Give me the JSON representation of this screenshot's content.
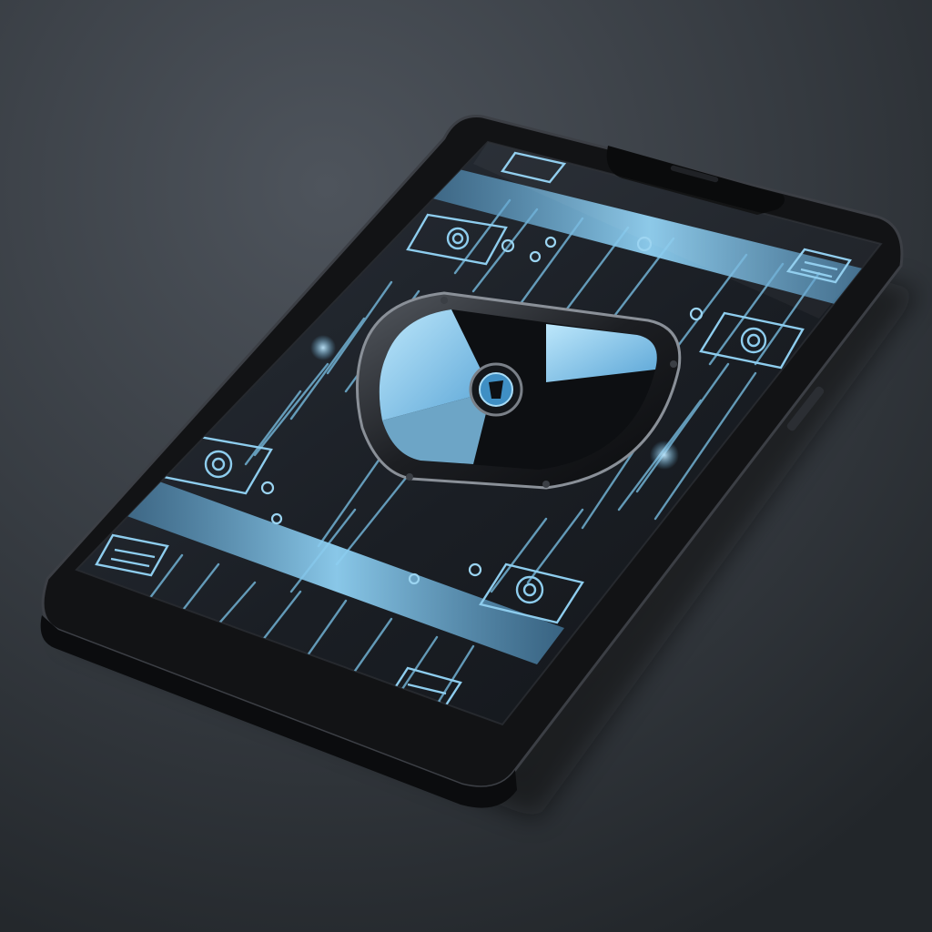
{
  "scene": {
    "subject": "smartphone-with-security-shield",
    "palette": {
      "background_light": "#4a5058",
      "background_dark": "#1f2327",
      "phone_body": "#141517",
      "phone_rim": "#3a3d42",
      "screen": "#1c2128",
      "accent_blue": "#7cc4ea",
      "accent_blue_bright": "#a9dcf6",
      "shield_frame": "#202226",
      "shield_light": "#8fcdef",
      "shield_dark": "#0d0f12"
    },
    "icons": [
      "shield-icon",
      "fingerprint-icon",
      "lock-icon",
      "keypad-icon",
      "circuit-line"
    ]
  }
}
